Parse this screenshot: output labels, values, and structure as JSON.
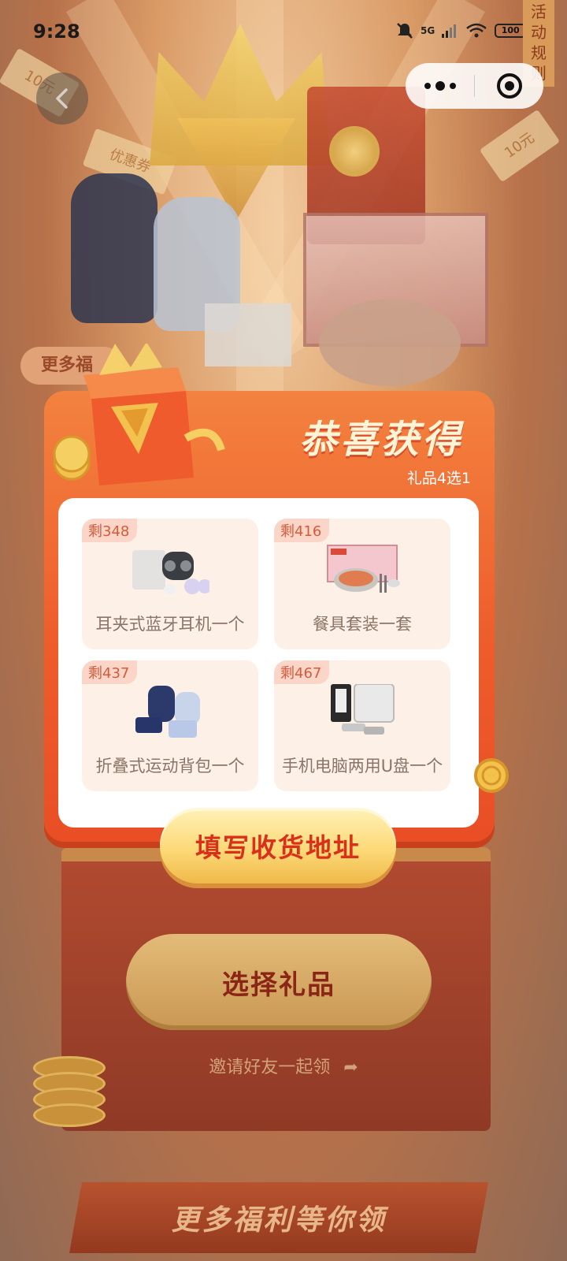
{
  "status_bar": {
    "time": "9:28",
    "network": "5G",
    "wifi": "6",
    "battery": "100"
  },
  "top_bar": {
    "rules_tab": "活动规则",
    "rules_lines": [
      "活",
      "动",
      "规",
      "则"
    ]
  },
  "background": {
    "more_pill": "更多福",
    "choose_gift_button": "选择礼品",
    "invite_text": "邀请好友一起领",
    "bottom_banner": "更多福利等你领",
    "ticket_text": "10元",
    "coupon_text": "优惠券"
  },
  "modal": {
    "title": "恭喜获得",
    "subtitle": "礼品4选1",
    "gifts": [
      {
        "remaining": "剩348",
        "name": "耳夹式蓝牙耳机一个"
      },
      {
        "remaining": "剩416",
        "name": "餐具套装一套"
      },
      {
        "remaining": "剩437",
        "name": "折叠式运动背包一个"
      },
      {
        "remaining": "剩467",
        "name": "手机电脑两用U盘一个"
      }
    ],
    "fill_address_button": "填写收货地址"
  },
  "colors": {
    "modal_orange": "#ee5d2c",
    "button_text_red": "#d9301a",
    "badge_text": "#d65a3a",
    "card_bg": "#fdf0e6"
  }
}
